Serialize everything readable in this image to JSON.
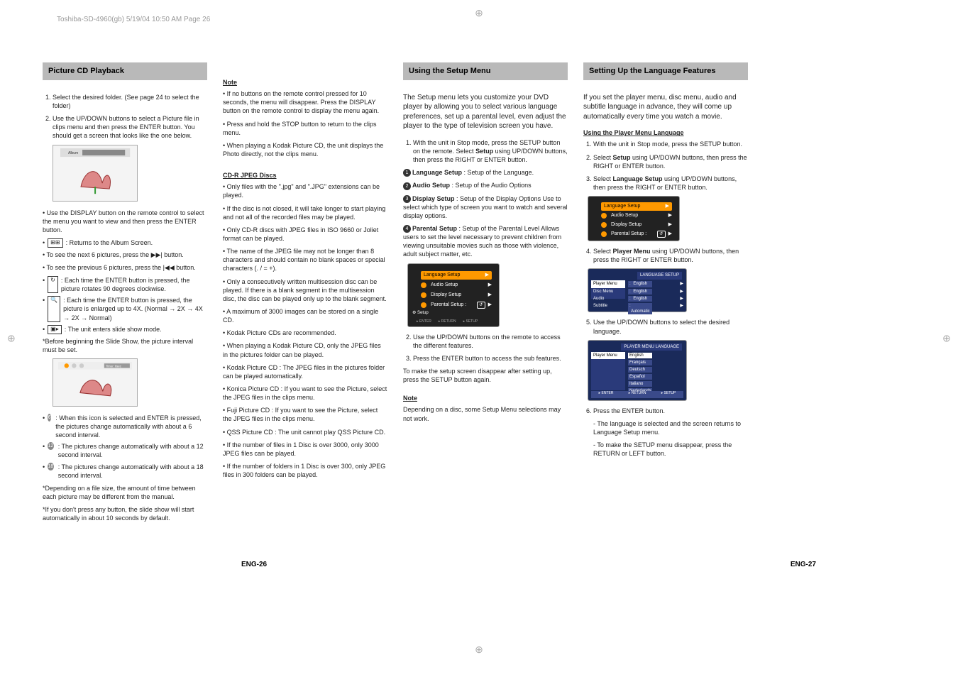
{
  "printHeader": "Toshiba-SD-4960(gb)  5/19/04  10:50 AM  Page 26",
  "col1": {
    "header": "Picture CD Playback",
    "step1": "Select the desired folder. (See page 24 to select the folder)",
    "step2": "Use the UP/DOWN buttons to select a Picture file in clips menu and then press the ENTER button. You should get a screen that looks like the one below.",
    "thumbLabel": "Album",
    "p_display": "• Use the DISPLAY button on the remote control to select the menu you want to view and then press the ENTER button.",
    "b_album": ": Returns to the Album Screen.",
    "b_next6": "• To see the next 6 pictures, press the ▶▶| button.",
    "b_prev6": "• To see the previous 6 pictures, press the |◀◀ button.",
    "b_rotate": ": Each time the ENTER button is pressed, the picture rotates 90 degrees clockwise.",
    "b_zoom": ": Each time the ENTER button is pressed, the picture is enlarged up to 4X. (Normal → 2X → 4X → 2X → Normal)",
    "b_slide": ": The unit enters slide show mode.",
    "p_beforeSlide": "*Before beginning the Slide Show, the picture interval must be set.",
    "b_6s": ": When this icon is selected and ENTER is pressed, the pictures change automatically with about a 6 second interval.",
    "b_12s": ": The pictures change automatically with about a 12 second interval.",
    "b_18s": ": The pictures change automatically with about a 18 second interval.",
    "foot1": "*Depending on a file size, the amount of time between each picture may be different from the manual.",
    "foot2": "*If you don't press any button, the slide show will start automatically in about 10 seconds by default."
  },
  "col2": {
    "noteHdr": "Note",
    "n1": "• If no buttons on the remote control pressed for 10 seconds, the menu will disappear. Press the DISPLAY button on the remote control to display the menu again.",
    "n2": "• Press and hold the STOP button to return to the clips menu.",
    "n3": "• When playing a Kodak Picture CD, the unit displays the Photo directly, not the clips menu.",
    "jpegHdr": "CD-R JPEG Discs",
    "j1": "• Only files with the \".jpg\" and \".JPG\" extensions can be played.",
    "j2": "• If the disc is not closed, it will take longer to start playing and not all of the recorded files may be played.",
    "j3": "• Only CD-R discs with JPEG files in ISO 9660 or Joliet format can be played.",
    "j4": "• The name of the JPEG file may not be longer than 8 characters and should contain no blank spaces or special characters (. / = +).",
    "j5": "• Only a consecutively written multisession disc can be played. If there is a blank segment in the multisession disc, the disc can be played only up to the blank segment.",
    "j6": "• A maximum of 3000 images can be stored on a single CD.",
    "j7": "• Kodak Picture CDs are recommended.",
    "j8": "• When playing a Kodak Picture CD, only the JPEG files in the pictures folder can be played.",
    "j9": "• Kodak Picture CD : The JPEG files in the pictures folder can be played automatically.",
    "j10": "• Konica Picture CD : If you want to see the Picture, select the JPEG files in the clips menu.",
    "j11": "• Fuji Picture CD : If you want to see the Picture, select the JPEG files in the clips menu.",
    "j12": "• QSS Picture CD : The unit cannot play QSS Picture CD.",
    "j13": "• If the number of files in 1 Disc is over 3000, only 3000 JPEG files can be played.",
    "j14": "• If the number of folders in 1 Disc is over 300, only JPEG files in 300 folders can be played."
  },
  "col3": {
    "header": "Using the Setup Menu",
    "intro": "The Setup menu lets you customize your DVD player by allowing you to select various language preferences, set up a parental level, even adjust the player to the type of television screen you have.",
    "s1a": "With the unit in Stop mode, press the SETUP button on the remote. Select ",
    "s1b": "Setup",
    "s1c": " using UP/DOWN buttons, then press the RIGHT or ENTER button.",
    "opt1a": "Language Setup",
    "opt1b": " : Setup of the Language.",
    "opt2a": "Audio Setup",
    "opt2b": " : Setup of the Audio Options",
    "opt3a": "Display Setup",
    "opt3b": " : Setup of the Display Options Use to select which type of screen you want to watch and several display options.",
    "opt4a": "Parental Setup",
    "opt4b": " : Setup of the Parental Level Allows users to set the level necessary to prevent children from viewing unsuitable movies such as those with violence, adult subject matter, etc.",
    "menu": {
      "i1": "Language Setup",
      "i2": "Audio Setup",
      "i3": "Display Setup",
      "i4": "Parental Setup :",
      "b1": "ENTER",
      "b2": "RETURN",
      "b3": "SETUP",
      "lbl": "Setup"
    },
    "s2": "Use the UP/DOWN buttons on the remote to access the different features.",
    "s3": "Press the ENTER button to access the sub features.",
    "p_dismiss": "To make the setup screen disappear after setting up, press the SETUP button again.",
    "noteHdr": "Note",
    "noteBody": "Depending on a disc, some Setup Menu selections may not work."
  },
  "col4": {
    "header": "Setting Up the Language Features",
    "intro": "If you set the player menu, disc menu, audio and subtitle language in advance, they will come up automatically every time you watch a movie.",
    "subHdr": "Using the Player Menu Language",
    "s1": "With the unit in Stop mode, press the SETUP button.",
    "s2a": "Select ",
    "s2b": "Setup",
    "s2c": " using UP/DOWN buttons, then press the RIGHT or ENTER button.",
    "s3a": "Select ",
    "s3b": "Language Setup",
    "s3c": " using UP/DOWN buttons, then press the RIGHT or ENTER button.",
    "s4a": "Select ",
    "s4b": "Player Menu",
    "s4c": " using UP/DOWN buttons, then press the RIGHT or ENTER button.",
    "menu2": {
      "hdr": "LANGUAGE SETUP",
      "l1": "Player Menu",
      "l2": "Disc Menu",
      "l3": "Audio",
      "l4": "Subtitle",
      "r1": "English",
      "r2": "English",
      "r3": "English",
      "r4": "Automatic"
    },
    "s5": "Use the UP/DOWN buttons to select the desired language.",
    "menu3": {
      "hdr": "PLAYER MENU LANGUAGE",
      "left": "Player Menu",
      "o1": "English",
      "o2": "Français",
      "o3": "Deutsch",
      "o4": "Español",
      "o5": "Italiano",
      "o6": "Nederlands",
      "b1": "ENTER",
      "b2": "RETURN",
      "b3": "SETUP"
    },
    "s6": "Press the ENTER button.",
    "s6a": "- The language is selected and the screen returns to Language Setup menu.",
    "s6b": "- To make the SETUP menu disappear, press the RETURN or LEFT button."
  },
  "pageLeft": "ENG-26",
  "pageRight": "ENG-27"
}
